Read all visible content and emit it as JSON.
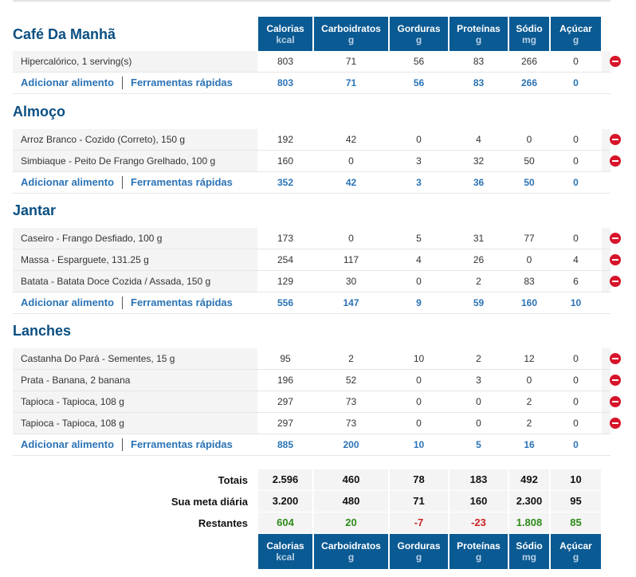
{
  "columns": [
    {
      "name": "Calorias",
      "unit": "kcal"
    },
    {
      "name": "Carboidratos",
      "unit": "g"
    },
    {
      "name": "Gorduras",
      "unit": "g"
    },
    {
      "name": "Proteínas",
      "unit": "g"
    },
    {
      "name": "Sódio",
      "unit": "mg"
    },
    {
      "name": "Açúcar",
      "unit": "g"
    }
  ],
  "links": {
    "add": "Adicionar alimento",
    "tools": "Ferramentas rápidas"
  },
  "meals": [
    {
      "title": "Café Da Manhã",
      "items": [
        {
          "food": "Hipercalórico, 1 serving(s)",
          "values": [
            "803",
            "71",
            "56",
            "83",
            "266",
            "0"
          ]
        }
      ],
      "sums": [
        "803",
        "71",
        "56",
        "83",
        "266",
        "0"
      ]
    },
    {
      "title": "Almoço",
      "items": [
        {
          "food": "Arroz Branco - Cozido (Correto), 150 g",
          "values": [
            "192",
            "42",
            "0",
            "4",
            "0",
            "0"
          ]
        },
        {
          "food": "Simbiaque - Peito De Frango Grelhado, 100 g",
          "values": [
            "160",
            "0",
            "3",
            "32",
            "50",
            "0"
          ]
        }
      ],
      "sums": [
        "352",
        "42",
        "3",
        "36",
        "50",
        "0"
      ]
    },
    {
      "title": "Jantar",
      "items": [
        {
          "food": "Caseiro - Frango Desfiado, 100 g",
          "values": [
            "173",
            "0",
            "5",
            "31",
            "77",
            "0"
          ]
        },
        {
          "food": "Massa - Esparguete, 131.25 g",
          "values": [
            "254",
            "117",
            "4",
            "26",
            "0",
            "4"
          ]
        },
        {
          "food": "Batata - Batata Doce Cozida / Assada, 150 g",
          "values": [
            "129",
            "30",
            "0",
            "2",
            "83",
            "6"
          ]
        }
      ],
      "sums": [
        "556",
        "147",
        "9",
        "59",
        "160",
        "10"
      ]
    },
    {
      "title": "Lanches",
      "items": [
        {
          "food": "Castanha Do Pará - Sementes, 15 g",
          "values": [
            "95",
            "2",
            "10",
            "2",
            "12",
            "0"
          ]
        },
        {
          "food": "Prata - Banana, 2 banana",
          "values": [
            "196",
            "52",
            "0",
            "3",
            "0",
            "0"
          ]
        },
        {
          "food": "Tapioca - Tapioca, 108 g",
          "values": [
            "297",
            "73",
            "0",
            "0",
            "2",
            "0"
          ]
        },
        {
          "food": "Tapioca - Tapioca, 108 g",
          "values": [
            "297",
            "73",
            "0",
            "0",
            "2",
            "0"
          ]
        }
      ],
      "sums": [
        "885",
        "200",
        "10",
        "5",
        "16",
        "0"
      ]
    }
  ],
  "totals": {
    "totais": {
      "label": "Totais",
      "values": [
        "2.596",
        "460",
        "78",
        "183",
        "492",
        "10"
      ]
    },
    "meta": {
      "label": "Sua meta diária",
      "values": [
        "3.200",
        "480",
        "71",
        "160",
        "2.300",
        "95"
      ]
    },
    "restantes": {
      "label": "Restantes",
      "values": [
        "604",
        "20",
        "-7",
        "-23",
        "1.808",
        "85"
      ]
    }
  },
  "colors": {
    "header_bg": "#0a5a93",
    "link": "#2b73b5",
    "positive": "#2e8b1a",
    "negative": "#cc2222",
    "delete": "#d7142a"
  }
}
